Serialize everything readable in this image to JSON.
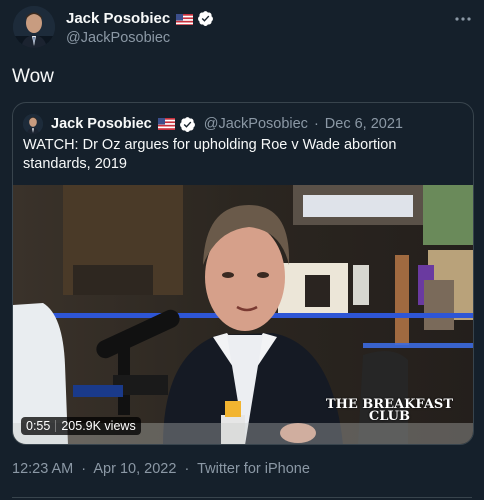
{
  "tweet": {
    "author": {
      "name": "Jack Posobiec",
      "handle": "@JackPosobiec"
    },
    "text": "Wow",
    "more_icon": "more-horizontal-icon"
  },
  "quoted": {
    "author": {
      "name": "Jack Posobiec",
      "handle": "@JackPosobiec"
    },
    "date_sep": "·",
    "date": "Dec 6, 2021",
    "text": "WATCH: Dr Oz argues for upholding Roe v Wade abortion standards, 2019",
    "video": {
      "duration": "0:55",
      "views": "205.9K views",
      "logo_line1": "THE BREAKFAST",
      "logo_line2": "CLUB"
    }
  },
  "footer": {
    "time": "12:23 AM",
    "sep": "·",
    "date": "Apr 10, 2022",
    "sep2": "·",
    "source": "Twitter for iPhone"
  },
  "colors": {
    "background": "#15202b",
    "text": "#f7f9f9",
    "muted": "#8b98a5",
    "border": "#38444d",
    "verified": "#ffffff"
  }
}
